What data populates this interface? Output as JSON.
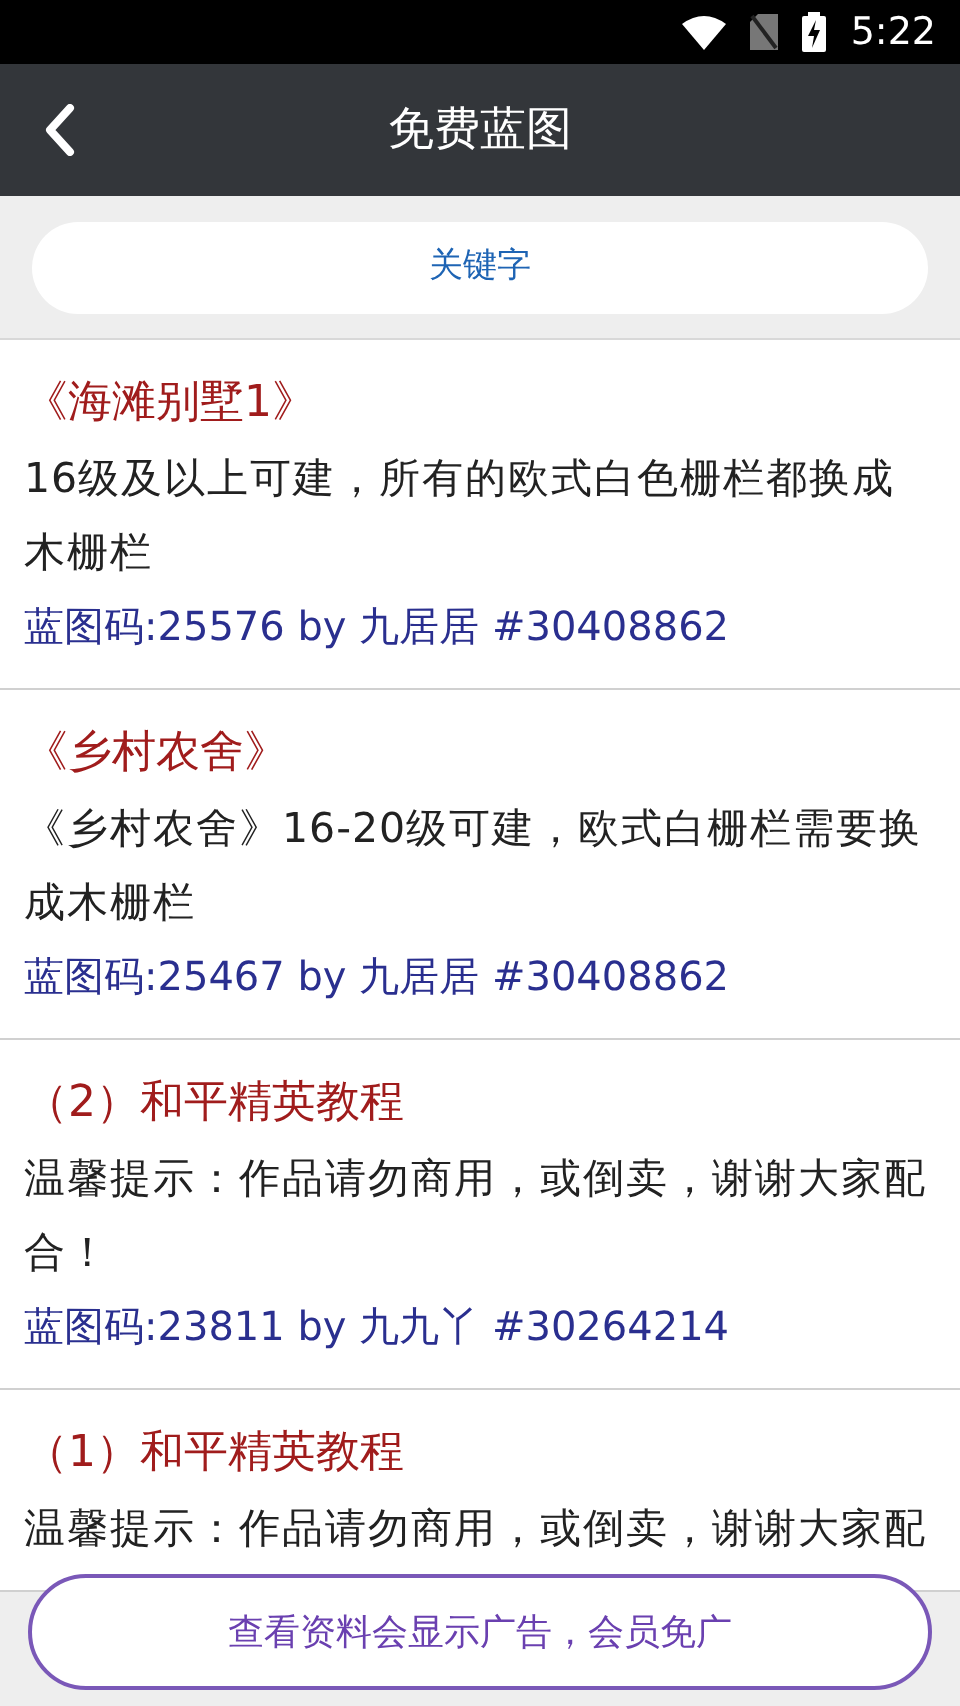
{
  "status_bar": {
    "time": "5:22"
  },
  "header": {
    "title": "免费蓝图"
  },
  "search": {
    "placeholder": "关键字"
  },
  "items": [
    {
      "title": "《海滩别墅1》",
      "description": "16级及以上可建，所有的欧式白色栅栏都换成木栅栏",
      "code": "蓝图码:25576 by 九居居 #30408862"
    },
    {
      "title": "《乡村农舍》",
      "description": "《乡村农舍》16-20级可建，欧式白栅栏需要换成木栅栏",
      "code": "蓝图码:25467 by 九居居 #30408862"
    },
    {
      "title": "（2）和平精英教程",
      "description": "温馨提示：作品请勿商用，或倒卖，谢谢大家配合！",
      "code": "蓝图码:23811 by 九九丫 #30264214"
    },
    {
      "title": "（1）和平精英教程",
      "description": "温馨提示：作品请勿商用，或倒卖，谢谢大家配"
    }
  ],
  "bottom_button": {
    "label": "查看资料会显示广告，会员免广"
  }
}
